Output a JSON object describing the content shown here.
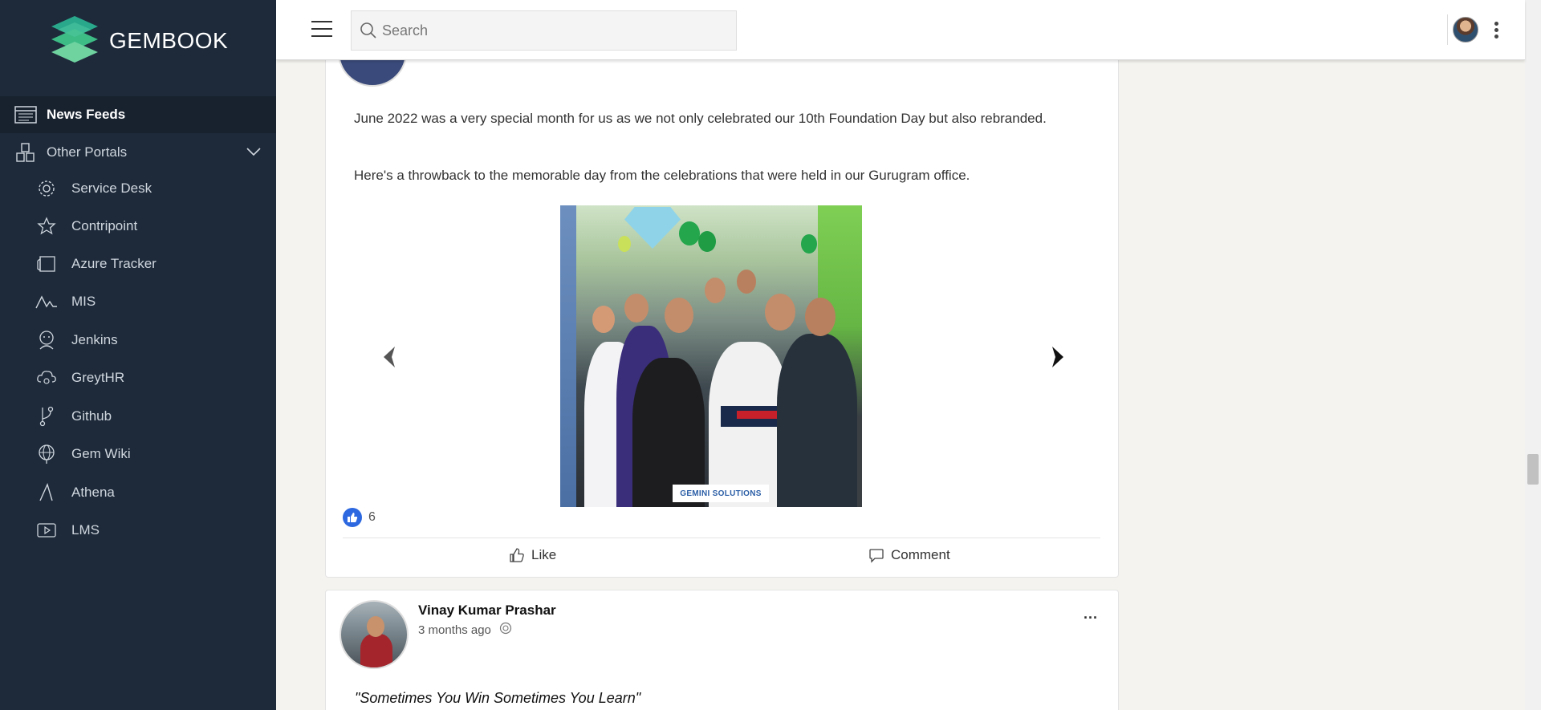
{
  "app": {
    "brand": "GEMBOOK"
  },
  "sidebar": {
    "news_feeds": "News Feeds",
    "other_portals": "Other Portals",
    "items": [
      {
        "label": "Service Desk",
        "icon": "gear-icon"
      },
      {
        "label": "Contripoint",
        "icon": "star-icon"
      },
      {
        "label": "Azure Tracker",
        "icon": "tracker-icon"
      },
      {
        "label": "MIS",
        "icon": "mis-icon"
      },
      {
        "label": "Jenkins",
        "icon": "jenkins-icon"
      },
      {
        "label": "GreytHR",
        "icon": "cloud-icon"
      },
      {
        "label": "Github",
        "icon": "branch-icon"
      },
      {
        "label": "Gem Wiki",
        "icon": "globe-icon"
      },
      {
        "label": "Athena",
        "icon": "triangle-icon"
      },
      {
        "label": "LMS",
        "icon": "video-icon"
      }
    ]
  },
  "header": {
    "search_placeholder": "Search"
  },
  "post1": {
    "text1": "June 2022 was a very special month for us as we not only celebrated our 10th Foundation Day but also rebranded.",
    "text2": "Here's a throwback to the memorable day from the celebrations that were held in our Gurugram office.",
    "image_caption": "GEMINI SOLUTIONS",
    "like_count": "6",
    "like_label": "Like",
    "comment_label": "Comment"
  },
  "post2": {
    "author": "Vinay Kumar Prashar",
    "time": "3 months ago",
    "menu": "...",
    "quote": "\"Sometimes You Win Sometimes You Learn\""
  },
  "colors": {
    "sidebar_bg": "#1e2a3a",
    "sidebar_active_bg": "#18222f",
    "like_badge": "#2d68e0",
    "logo_green": "#3ab783"
  }
}
